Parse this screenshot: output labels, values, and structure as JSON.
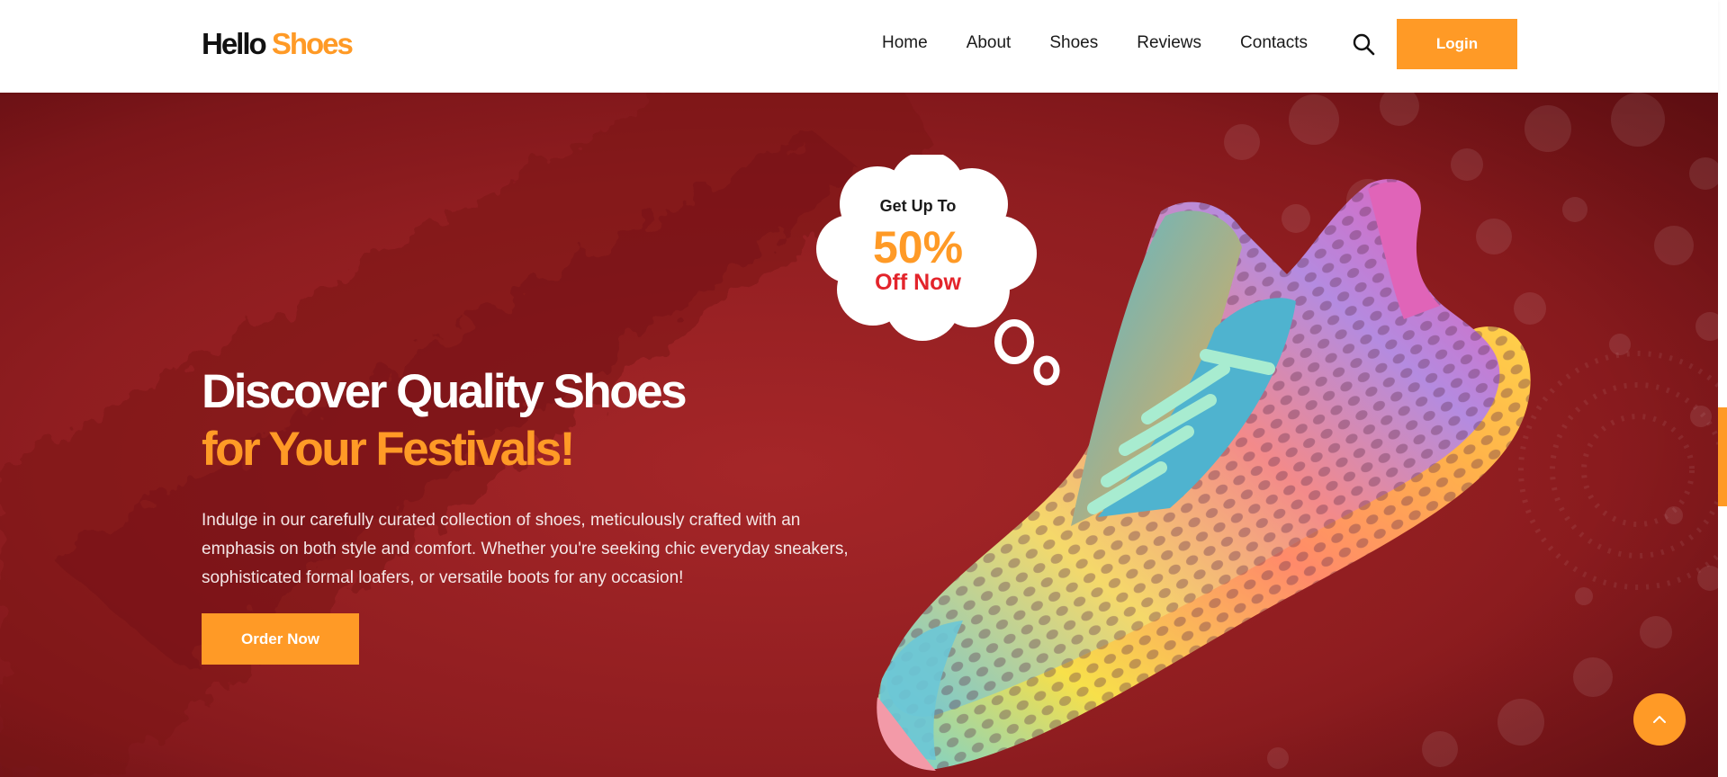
{
  "header": {
    "logo_word1": "Hello",
    "logo_word2": "Shoes",
    "nav": [
      "Home",
      "About",
      "Shoes",
      "Reviews",
      "Contacts"
    ],
    "login_label": "Login"
  },
  "hero": {
    "headline_line1": "Discover Quality Shoes",
    "headline_line2": "for Your Festivals!",
    "description": "Indulge in our carefully curated collection of shoes, meticulously crafted with an emphasis on both style and comfort. Whether you're seeking chic everyday sneakers, sophisticated formal loafers, or versatile boots for any occasion!",
    "order_label": "Order Now"
  },
  "promo": {
    "top": "Get Up To",
    "percent": "50%",
    "bottom": "Off Now"
  },
  "icons": {
    "search": "search-icon",
    "back_to_top": "chevron-up-icon"
  },
  "colors": {
    "accent": "#ff9a26",
    "hero_bg": "#8f1d20",
    "promo_red": "#e3242b",
    "text_dark": "#1a1a1a"
  }
}
